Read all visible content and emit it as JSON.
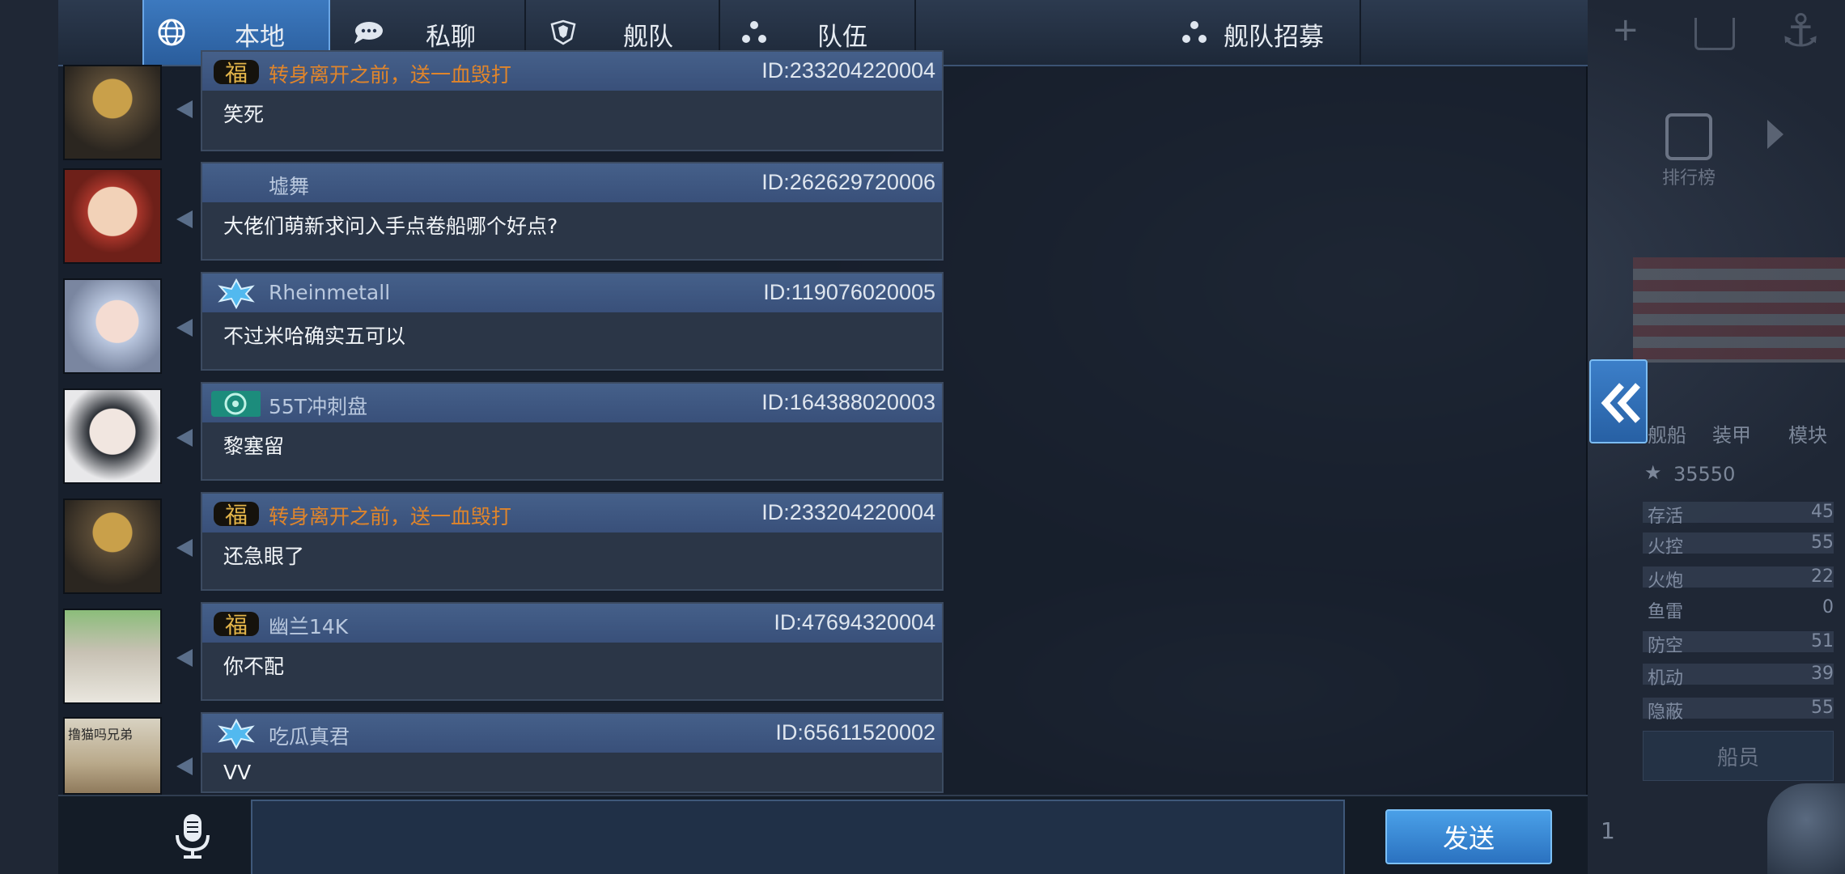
{
  "tabs": [
    {
      "label": "本地",
      "icon": "globe-icon",
      "active": true
    },
    {
      "label": "私聊",
      "icon": "chat-bubble-icon",
      "active": false
    },
    {
      "label": "舰队",
      "icon": "fleet-emblem-icon",
      "active": false
    },
    {
      "label": "队伍",
      "icon": "team-dots-icon",
      "active": false
    },
    {
      "label": "舰队招募",
      "icon": "team-dots-icon",
      "active": false
    }
  ],
  "messages": [
    {
      "name": "转身离开之前，送一血毁打",
      "name_color": "orange",
      "badge": "fu-badge-icon",
      "id": "ID:233204220004",
      "text": "笑死"
    },
    {
      "name": "墟舞",
      "name_color": "blue",
      "badge": "",
      "id": "ID:262629720006",
      "text": "大佬们萌新求问入手点卷船哪个好点?"
    },
    {
      "name": "Rheinmetall",
      "name_color": "blue",
      "badge": "snowflake-badge-icon",
      "id": "ID:119076020005",
      "text": "不过米哈确实五可以"
    },
    {
      "name": "55T冲刺盘",
      "name_color": "blue",
      "badge": "teal-emblem-badge-icon",
      "id": "ID:164388020003",
      "text": "黎塞留"
    },
    {
      "name": "转身离开之前，送一血毁打",
      "name_color": "orange",
      "badge": "fu-badge-icon",
      "id": "ID:233204220004",
      "text": "还急眼了"
    },
    {
      "name": "幽兰14K",
      "name_color": "blue",
      "badge": "fu-badge-icon",
      "id": "ID:47694320004",
      "text": "你不配"
    },
    {
      "name": "吃瓜真君",
      "name_color": "blue",
      "badge": "snowflake-badge-icon",
      "id": "ID:65611520002",
      "text": "VV"
    }
  ],
  "avatar_caption": "撸猫吗兄弟",
  "input": {
    "value": "",
    "placeholder": ""
  },
  "send_label": "发送",
  "hud": {
    "rating_star": "35550",
    "tabs": [
      "舰船",
      "装甲",
      "模块"
    ],
    "stats": [
      {
        "k": "存活",
        "v": "45"
      },
      {
        "k": "火控",
        "v": "55"
      },
      {
        "k": "火炮",
        "v": "22"
      },
      {
        "k": "鱼雷",
        "v": "0"
      },
      {
        "k": "防空",
        "v": "51"
      },
      {
        "k": "机动",
        "v": "39"
      },
      {
        "k": "隐蔽",
        "v": "55"
      }
    ],
    "crew_label": "船员",
    "ranking_label": "排行榜",
    "page_num": "1"
  },
  "colors": {
    "accent": "#2a5d9c",
    "orange_name": "#e0852b",
    "bubble_head": "#45608a"
  }
}
